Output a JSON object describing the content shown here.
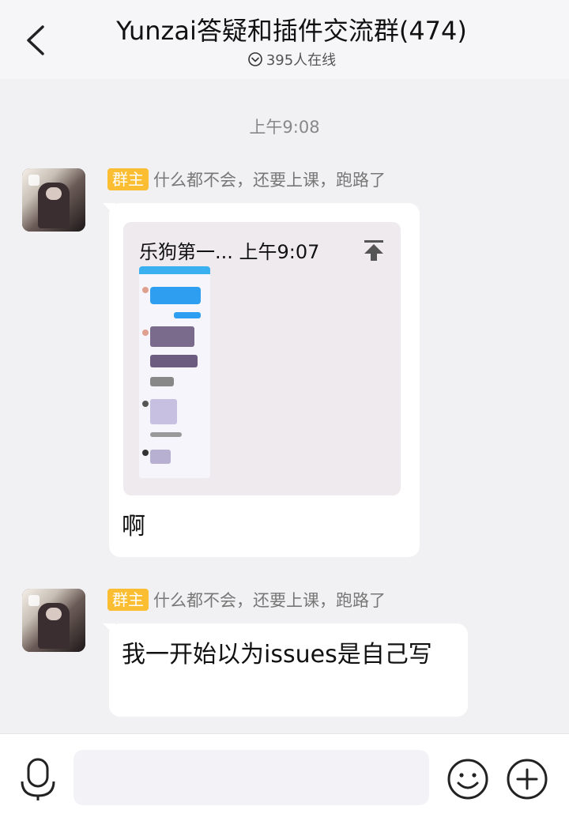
{
  "header": {
    "title": "Yunzai答疑和插件交流群(474)",
    "online_text": "395人在线"
  },
  "timestamp": "上午9:08",
  "messages": [
    {
      "role": "群主",
      "sender": "什么都不会，还要上课，跑路了",
      "forward": {
        "title": "乐狗第一...  上午9:07"
      },
      "text": "啊"
    },
    {
      "role": "群主",
      "sender": "什么都不会，还要上课，跑路了",
      "text": "我一开始以为issues是自己写"
    }
  ],
  "colors": {
    "role_badge": "#fbbd32",
    "background": "#f1f1f3"
  },
  "icons": [
    "back-icon",
    "online-status-icon",
    "pin-up-icon",
    "mic-icon",
    "emoji-icon",
    "plus-icon"
  ]
}
